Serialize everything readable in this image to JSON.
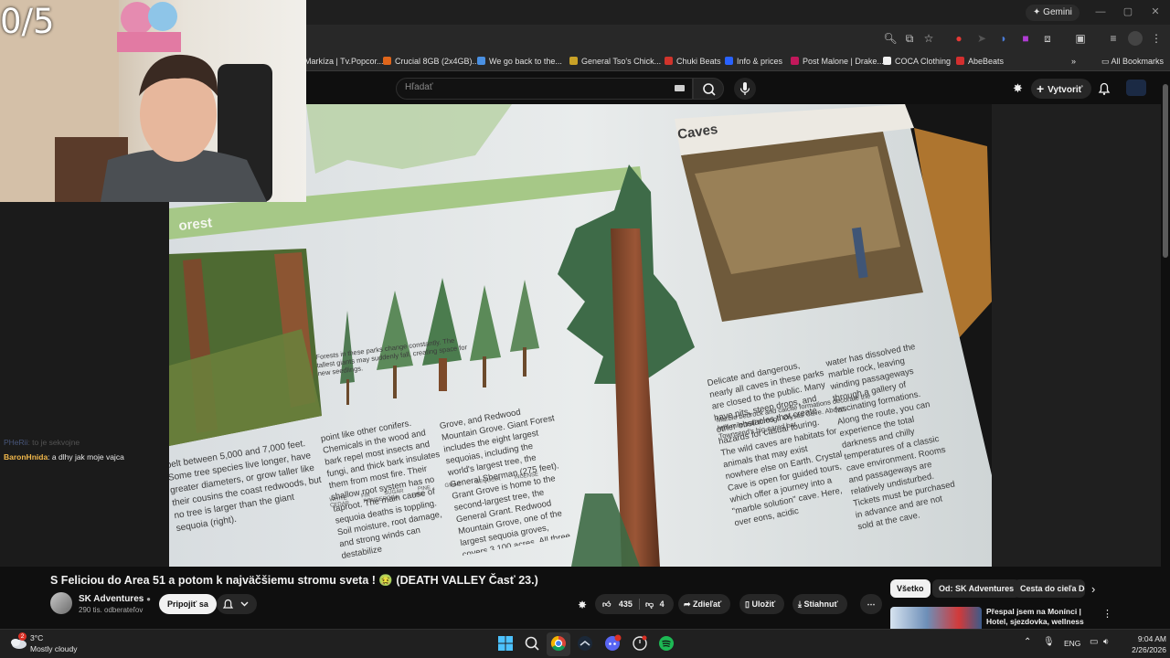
{
  "overlay": {
    "counter": "0/5",
    "chat": [
      {
        "user": "PHeRii",
        "message": ": to je sekvojne"
      },
      {
        "user": "BaronHnida",
        "message": ": a dlhy jak moje vajca"
      }
    ]
  },
  "browser": {
    "gemini_label": "Gemini",
    "bookmarks": [
      {
        "label": "Markíza | Tv.Popcor...",
        "color": "#e9a23b"
      },
      {
        "label": "Crucial 8GB (2x4GB)...",
        "color": "#e0661b"
      },
      {
        "label": "We go back to the...",
        "color": "#4a90e2"
      },
      {
        "label": "General Tso's Chick...",
        "color": "#c9a227"
      },
      {
        "label": "Chuki Beats",
        "color": "#d0342c"
      },
      {
        "label": "Info & prices",
        "color": "#2962ff"
      },
      {
        "label": "Post Malone | Drake...",
        "color": "#c2185b"
      },
      {
        "label": "COCA Clothing",
        "color": "#111111"
      },
      {
        "label": "AbeBeats",
        "color": "#d32f2f"
      }
    ],
    "all_bookmarks": "All Bookmarks"
  },
  "youtube": {
    "search_placeholder": "Hľadať",
    "create_label": "Vytvoriť",
    "video_title": "S Feliciou do Area 51 a potom k najväčšiemu stromu sveta ! 🤢 (DEATH VALLEY Časť 23.)",
    "channel": {
      "name": "SK Adventures",
      "subscribers": "290 tis. odberateľov",
      "join_label": "Pripojiť sa"
    },
    "actions": {
      "likes": "435",
      "dislikes": "4",
      "share": "Zdieľať",
      "save": "Uložiť",
      "download": "Stiahnuť"
    },
    "chips": [
      "Všetko",
      "Od: SK Adventures",
      "Cesta do cieľa Do"
    ],
    "recommended": {
      "title": "Přespal jsem na Monínci | Hotel, sjezdovka, wellness"
    }
  },
  "video_frame": {
    "heading_caves": "Caves",
    "heading_forest": "orest",
    "caption_forest": "Forests in these parks change constantly. The tallest giants may suddenly fall, creating space for new seedlings.",
    "tree_labels": [
      "WHITE FIR",
      "SUGAR PINE",
      "GIANT SEQUOIA",
      "INCENSE CEDAR",
      "PONDEROSA PINE"
    ],
    "caption_caves": "Marble bedrock and calcite formations decorate the half-mile trail through Crystal Cave. Above: Townsend's big-eared bat",
    "col_a": "belt between 5,000 and 7,000 feet. Some tree species live longer, have greater diameters, or grow taller like their cousins the coast redwoods, but no tree is larger than the giant sequoia (right).",
    "col_b": "point like other conifers. Chemicals in the wood and bark repel most insects and fungi, and thick bark insulates them from most fire. Their shallow root system has no taproot. The main cause of sequoia deaths is toppling. Soil moisture, root damage, and strong winds can destabilize",
    "col_c": "Grove, and Redwood Mountain Grove. Giant Forest includes the eight largest sequoias, including the world's largest tree, the General Sherman (275 feet). Grant Grove is home to the second-largest tree, the General Grant. Redwood Mountain Grove, one of the largest sequoia groves, covers 3,100 acres. All three",
    "col_d": "Delicate and dangerous, nearly all caves in these parks are closed to the public. Many have pits, steep drops, and other obstacles that create hazards for casual touring. The wild caves are habitats for animals that may exist nowhere else on Earth. Crystal Cave is open for guided tours, which offer a journey into a \"marble solution\" cave. Here, over eons, acidic",
    "col_e": "water has dissolved the marble rock, leaving winding passageways through a gallery of fascinating formations. Along the route, you can experience the total darkness and chilly temperatures of a classic cave environment. Rooms and passageways are relatively undisturbed. Tickets must be purchased in advance and are not sold at the cave."
  },
  "taskbar": {
    "weather_temp": "3°C",
    "weather_cond": "Mostly cloudy",
    "weather_badge": "2",
    "lang": "ENG",
    "time": "9:04 AM",
    "date": "2/26/2026"
  }
}
